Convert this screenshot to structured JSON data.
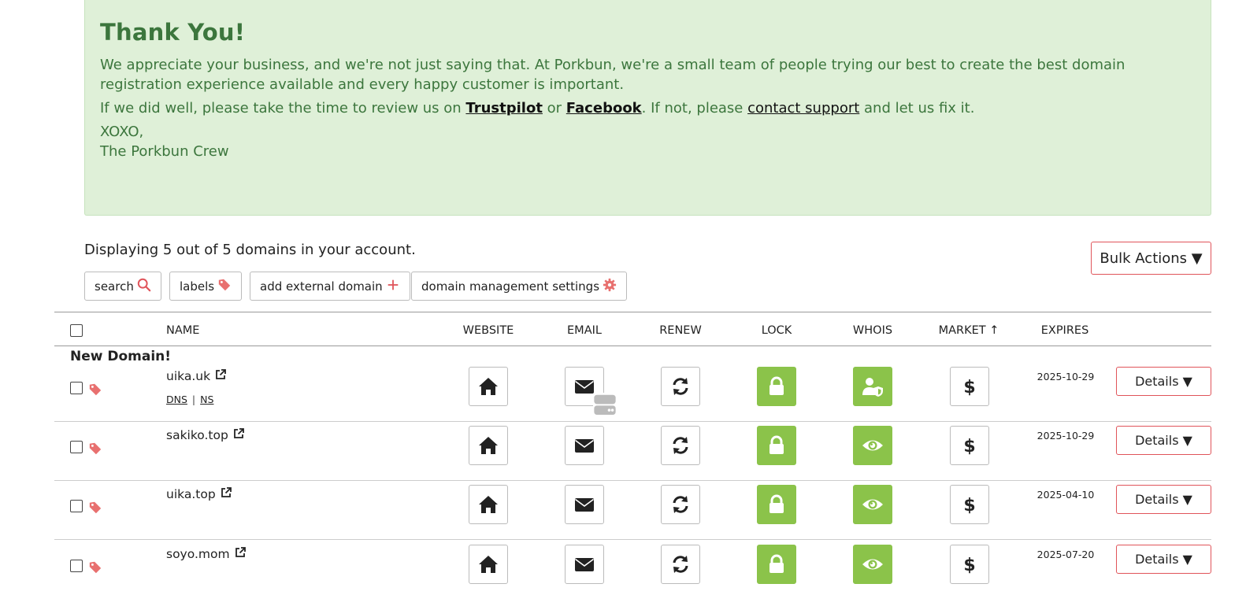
{
  "thanks": {
    "title": "Thank You!",
    "p1": "We appreciate your business, and we're not just saying that. At Porkbun, we're a small team of people trying our best to create the best domain registration experience available and every happy customer is important.",
    "p2_pre": "If we did well, please take the time to review us on ",
    "trustpilot": "Trustpilot",
    "or": " or ",
    "facebook": "Facebook",
    "p2_mid": ". If not, please ",
    "contact": "contact support",
    "p2_post": " and let us fix it.",
    "sign1": "XOXO,",
    "sign2": "The Porkbun Crew"
  },
  "summary": "Displaying 5 out of 5 domains in your account.",
  "toolbar": {
    "search": "search",
    "labels": "labels",
    "add_external": "add external domain",
    "settings": "domain management settings",
    "bulk": "Bulk Actions ▼"
  },
  "columns": {
    "name": "NAME",
    "website": "WEBSITE",
    "email": "EMAIL",
    "renew": "RENEW",
    "lock": "LOCK",
    "whois": "WHOIS",
    "market": "MARKET",
    "market_arrow": "↑",
    "expires": "EXPIRES"
  },
  "new_domain_label": "New Domain!",
  "dns_links": {
    "dns": "DNS",
    "sep": "|",
    "ns": "NS"
  },
  "details_label": "Details ▼",
  "domains": [
    {
      "name": "uika.uk",
      "expires": "2025-10-29",
      "whois_icon": "user-shield-icon",
      "email_icon": "envelope-server-icon"
    },
    {
      "name": "sakiko.top",
      "expires": "2025-10-29",
      "whois_icon": "eye-icon",
      "email_icon": "envelope-icon"
    },
    {
      "name": "uika.top",
      "expires": "2025-04-10",
      "whois_icon": "eye-icon",
      "email_icon": "envelope-icon"
    },
    {
      "name": "soyo.mom",
      "expires": "2025-07-20",
      "whois_icon": "eye-icon",
      "email_icon": "envelope-icon"
    }
  ],
  "colors": {
    "success_bg": "#dff0d8",
    "success_text": "#3c763d",
    "accent": "#e0545a",
    "green": "#8bc34a"
  }
}
